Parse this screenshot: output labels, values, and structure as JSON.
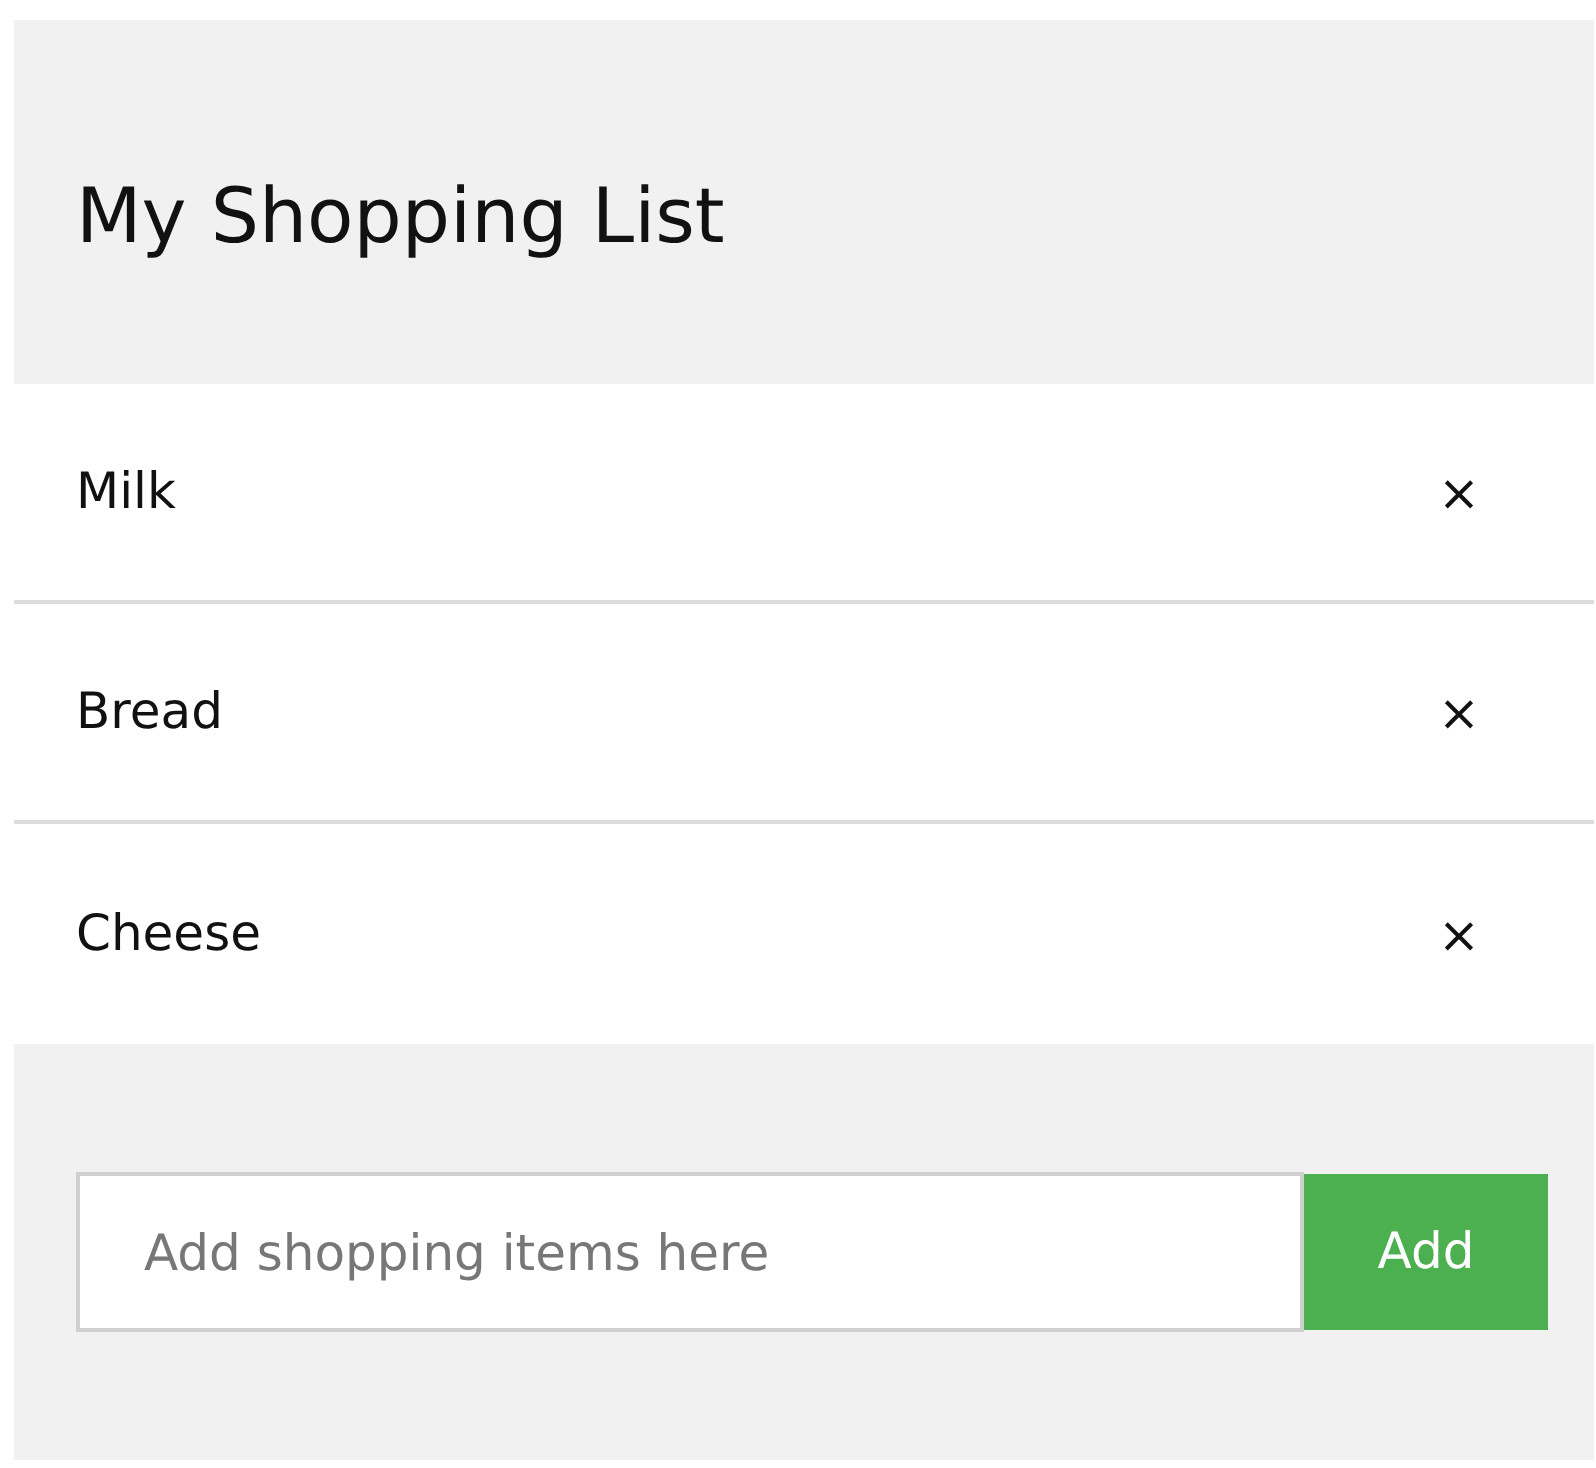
{
  "header": {
    "title": "My Shopping List"
  },
  "items": [
    {
      "name": "Milk",
      "remove": "×"
    },
    {
      "name": "Bread",
      "remove": "×"
    },
    {
      "name": "Cheese",
      "remove": "×"
    }
  ],
  "add_form": {
    "placeholder": "Add shopping items here",
    "button": "Add"
  }
}
